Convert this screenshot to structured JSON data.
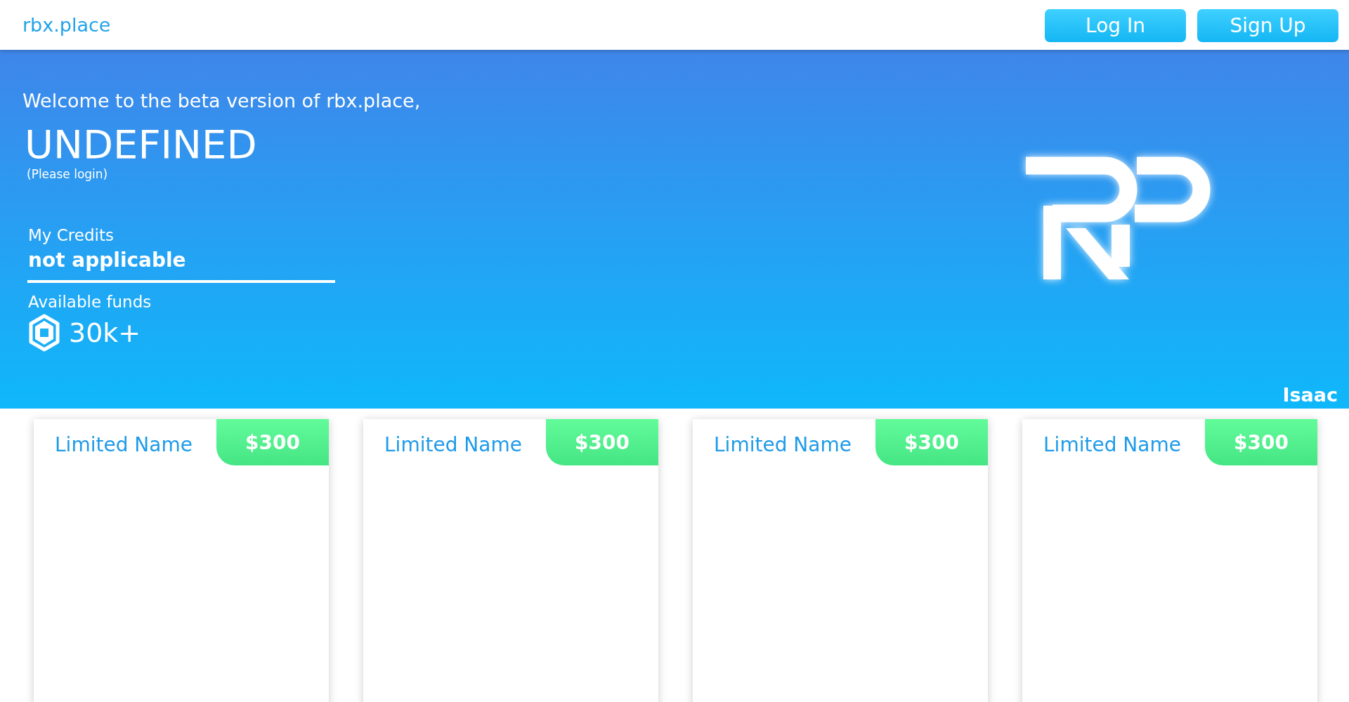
{
  "header": {
    "brand": "rbx.place",
    "buttons": [
      "Log In",
      "Sign Up"
    ]
  },
  "hero": {
    "greeting": "Welcome to the beta version of rbx.place,",
    "username": "UNDEFINED",
    "note": "(Please login)",
    "credits_label": "My Credits",
    "credits_value": "not applicable",
    "funds_label": "Available funds",
    "funds_value": "30k+",
    "author": "Isaac"
  },
  "cards": [
    {
      "name": "Limited Name",
      "price": "$300"
    },
    {
      "name": "Limited Name",
      "price": "$300"
    },
    {
      "name": "Limited Name",
      "price": "$300"
    },
    {
      "name": "Limited Name",
      "price": "$300"
    }
  ]
}
